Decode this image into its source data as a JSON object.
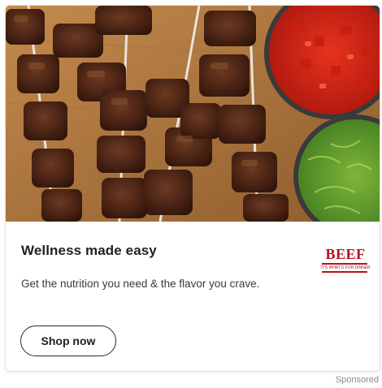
{
  "ad": {
    "headline": "Wellness made easy",
    "description": "Get the nutrition you need & the flavor you crave.",
    "cta_label": "Shop now",
    "sponsored_label": "Sponsored",
    "brand": {
      "logo_word": "BEEF",
      "logo_tagline": "IT'S WHAT'S FOR DINNER"
    }
  },
  "colors": {
    "brand_red": "#b3121f",
    "headline_text": "#222222",
    "body_text": "#3a3a3a",
    "muted_text": "#8a8a8a"
  },
  "icons": {
    "hero": "beef-kabob-skewers-photo",
    "logo": "beef-logo"
  }
}
